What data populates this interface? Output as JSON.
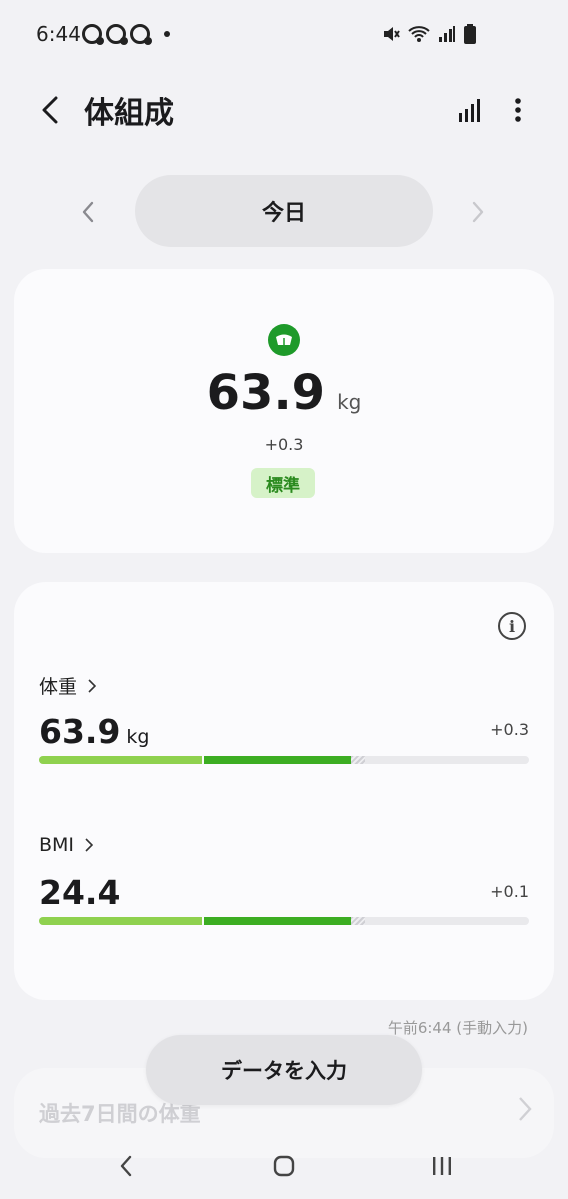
{
  "status_bar": {
    "time": "6:44"
  },
  "header": {
    "title": "体組成"
  },
  "date_selector": {
    "label": "今日"
  },
  "summary": {
    "weight": "63.9",
    "unit": "kg",
    "change": "+0.3",
    "status": "標準"
  },
  "metrics": [
    {
      "label": "体重",
      "value": "63.9",
      "unit": "kg",
      "change": "+0.3",
      "bar_fraction": 0.636
    },
    {
      "label": "BMI",
      "value": "24.4",
      "unit": "",
      "change": "+0.1",
      "bar_fraction": 0.636
    }
  ],
  "timestamp": "午前6:44 (手動入力)",
  "past_card": {
    "title": "過去7日間の体重"
  },
  "enter_button": {
    "label": "データを入力"
  },
  "colors": {
    "accent_green": "#1e9a2a",
    "bar_light": "#8fd14f",
    "bar_dark": "#3cad22",
    "badge_bg": "#d6f2c8"
  }
}
